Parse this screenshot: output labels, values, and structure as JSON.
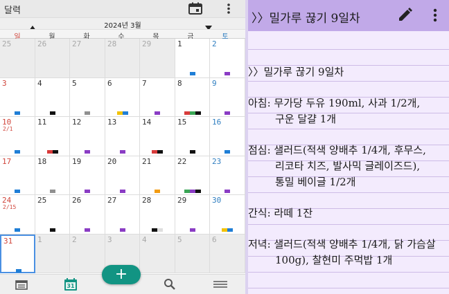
{
  "calendar": {
    "app_title": "달력",
    "month_label": "2024년 3월",
    "weekdays": [
      "일",
      "월",
      "화",
      "수",
      "목",
      "금",
      "토"
    ],
    "colors": {
      "blue": "#1f7ed6",
      "black": "#111111",
      "gray": "#909090",
      "yellow": "#f2c200",
      "purple": "#8a3cc4",
      "red": "#d83b3b",
      "green": "#3aa655",
      "orange": "#f39c12",
      "light": "#dedede",
      "fab": "#129483",
      "sunday": "#d0453b",
      "saturday": "#2f7ec0"
    },
    "weeks": [
      [
        {
          "day": "25",
          "other": true,
          "marks": []
        },
        {
          "day": "26",
          "other": true,
          "marks": []
        },
        {
          "day": "27",
          "other": true,
          "marks": []
        },
        {
          "day": "28",
          "other": true,
          "marks": []
        },
        {
          "day": "29",
          "other": true,
          "marks": []
        },
        {
          "day": "1",
          "marks": [
            "blue"
          ]
        },
        {
          "day": "2",
          "marks": [
            "purple"
          ]
        }
      ],
      [
        {
          "day": "3",
          "marks": [
            "blue"
          ]
        },
        {
          "day": "4",
          "marks": [
            "black"
          ]
        },
        {
          "day": "5",
          "marks": [
            "gray"
          ]
        },
        {
          "day": "6",
          "marks": [
            "yellow",
            "blue"
          ]
        },
        {
          "day": "7",
          "marks": [
            "purple"
          ]
        },
        {
          "day": "8",
          "marks": [
            "red",
            "green",
            "black"
          ]
        },
        {
          "day": "9",
          "marks": [
            "purple"
          ]
        }
      ],
      [
        {
          "day": "10",
          "lunar": "2/1",
          "marks": [
            "blue"
          ]
        },
        {
          "day": "11",
          "marks": [
            "red",
            "black"
          ]
        },
        {
          "day": "12",
          "marks": [
            "purple"
          ]
        },
        {
          "day": "13",
          "marks": [
            "purple"
          ]
        },
        {
          "day": "14",
          "marks": [
            "red",
            "black"
          ]
        },
        {
          "day": "15",
          "marks": [
            "black"
          ]
        },
        {
          "day": "16",
          "marks": [
            "blue"
          ]
        }
      ],
      [
        {
          "day": "17",
          "marks": [
            "blue"
          ]
        },
        {
          "day": "18",
          "marks": [
            "gray"
          ]
        },
        {
          "day": "19",
          "marks": [
            "purple"
          ]
        },
        {
          "day": "20",
          "marks": [
            "purple"
          ]
        },
        {
          "day": "21",
          "marks": [
            "orange"
          ]
        },
        {
          "day": "22",
          "marks": [
            "green",
            "purple",
            "black"
          ]
        },
        {
          "day": "23",
          "marks": [
            "purple"
          ]
        }
      ],
      [
        {
          "day": "24",
          "lunar": "2/15",
          "marks": [
            "blue"
          ]
        },
        {
          "day": "25",
          "marks": [
            "black"
          ]
        },
        {
          "day": "26",
          "marks": [
            "purple"
          ]
        },
        {
          "day": "27",
          "marks": [
            "purple"
          ]
        },
        {
          "day": "28",
          "marks": [
            "black",
            "light"
          ]
        },
        {
          "day": "29",
          "marks": [
            "purple"
          ]
        },
        {
          "day": "30",
          "marks": [
            "yellow",
            "blue"
          ]
        }
      ],
      [
        {
          "day": "31",
          "today": true,
          "marks": [
            "blue"
          ]
        },
        {
          "day": "1",
          "other": true,
          "marks": []
        },
        {
          "day": "2",
          "other": true,
          "marks": []
        },
        {
          "day": "3",
          "other": true,
          "marks": []
        },
        {
          "day": "4",
          "other": true,
          "marks": []
        },
        {
          "day": "5",
          "other": true,
          "marks": []
        },
        {
          "day": "6",
          "other": true,
          "marks": []
        }
      ]
    ],
    "fab_label": "+",
    "bottom_nav": {
      "icons": [
        "list-icon",
        "calendar-31-icon",
        "search-icon",
        "hamburger-menu-icon"
      ],
      "calendar_day": "31"
    }
  },
  "memo": {
    "title": "〉〉밀가루 끊기 9일차",
    "header_color": "#c1a9e8",
    "paper_color": "#f3ebfd",
    "lines": [
      "〉〉밀가루 끊기 9일차",
      "",
      "아침: 무가당 두유 190ml, 사과 1/2개,",
      "구운 달걀 1개",
      "",
      "점심: 샐러드(적색 양배추 1/4개, 후무스,",
      "리코타 치즈, 발사믹 글레이즈드),",
      "통밀 베이글 1/2개",
      "",
      "간식: 라떼 1잔",
      "",
      "저녁: 샐러드(적색 양배추 1/4개, 닭 가슴살",
      "100g), 찰현미 주먹밥 1개"
    ]
  }
}
